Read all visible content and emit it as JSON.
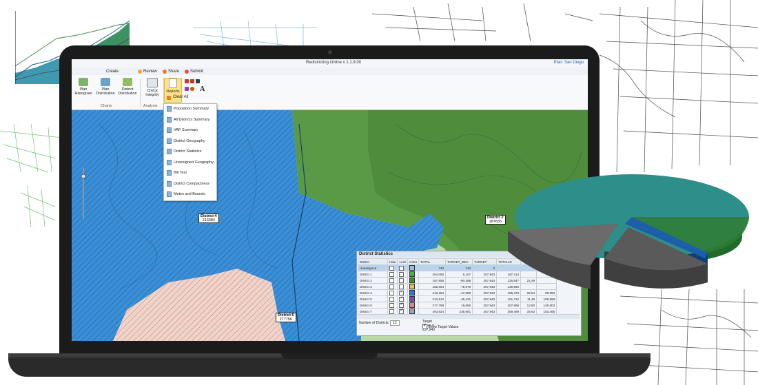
{
  "window": {
    "app_title": "Redistricting Online v 1.1.9.00",
    "plan_name": "Plan: San Diego"
  },
  "tabs": [
    "Create",
    "Review",
    "Share",
    "Submit"
  ],
  "ribbon": {
    "plan_histogram": "Plan Histogram",
    "plan_distribution": "Plan Distribution",
    "district_distribution": "District Distribution",
    "check_integrity": "Check Integrity",
    "reports": "Reports",
    "clear_all": "Clear All",
    "charts_group": "Charts",
    "analysis_group": "Analysis",
    "font_letter": "A"
  },
  "reports_menu": [
    "Population Summary",
    "All Districts Summary",
    "VAP Summary",
    "District Geography",
    "District Statistics",
    "Unassigned Geography",
    "Bill Text",
    "District Compactness",
    "Metes and Bounds"
  ],
  "map_labels": [
    {
      "name": "District 4",
      "value": "213384"
    },
    {
      "name": "District 2",
      "value": "187655"
    },
    {
      "name": "District 6",
      "value": "277756"
    }
  ],
  "district_statistics": {
    "title": "District Statistics",
    "columns": [
      "District",
      "Hide",
      "Lock",
      "Color",
      "TOTAL",
      "TARGET_DEV",
      "TARGET",
      "TOTAL18"
    ],
    "rows": [
      {
        "district": "Unassigned",
        "hide": false,
        "lock": false,
        "color": "#9dbbe0",
        "total": "742",
        "target_dev": "742",
        "target": "0",
        "total18": "",
        "extra1": "",
        "extra2": ""
      },
      {
        "district": "District 1",
        "hide": false,
        "lock": false,
        "color": "#4caf50",
        "total": "264,050",
        "target_dev": "6,107",
        "target": "257,943",
        "total18": "197,214",
        "extra1": "",
        "extra2": ""
      },
      {
        "district": "District 2",
        "hide": false,
        "lock": false,
        "color": "#3f8a3a",
        "total": "167,655",
        "target_dev": "-90,288",
        "target": "257,943",
        "total18": "126,547",
        "extra1": "21,49",
        "extra2": ""
      },
      {
        "district": "District 3",
        "hide": false,
        "lock": false,
        "color": "#e8c04a",
        "total": "182,064",
        "target_dev": "-75,879",
        "target": "257,943",
        "total18": "139,692",
        "extra1": "",
        "extra2": ""
      },
      {
        "district": "District 4",
        "hide": false,
        "lock": true,
        "color": "#2e7ad1",
        "total": "210,364",
        "target_dev": "-47,559",
        "target": "257,943",
        "total18": "155,476",
        "extra1": "25.64",
        "extra2": "99.550"
      },
      {
        "district": "District 5",
        "hide": false,
        "lock": true,
        "color": "#7b4fa8",
        "total": "212,512",
        "target_dev": "-45,431",
        "target": "257,943",
        "total18": "161,712",
        "extra1": "11.46",
        "extra2": "159.969"
      },
      {
        "district": "District 6",
        "hide": false,
        "lock": true,
        "color": "#d98a8a",
        "total": "277,799",
        "target_dev": "19,856",
        "target": "257,943",
        "total18": "207,695",
        "extra1": "12.50",
        "extra2": "145.503"
      },
      {
        "district": "District 7",
        "hide": false,
        "lock": true,
        "color": "#9aa6b3",
        "total": "493,624",
        "target_dev": "235,681",
        "target": "257,943",
        "total18": "359,469",
        "extra1": "34.62",
        "extra2": "103.465"
      }
    ],
    "num_districts_label": "Number of Districts:",
    "num_districts_value": "12",
    "target_mean": "Target Mean = 257,943",
    "show_target_values": "Show Target Values"
  },
  "colors": {
    "district_blue": "#3b8fd6",
    "district_green": "#4f8d3d",
    "district_pink": "#e8c2b8",
    "pie_teal": "#2a9c9c",
    "pie_blue": "#1c5fa8",
    "pie_green": "#2e7d32",
    "pie_gray": "#5e5e5e"
  }
}
